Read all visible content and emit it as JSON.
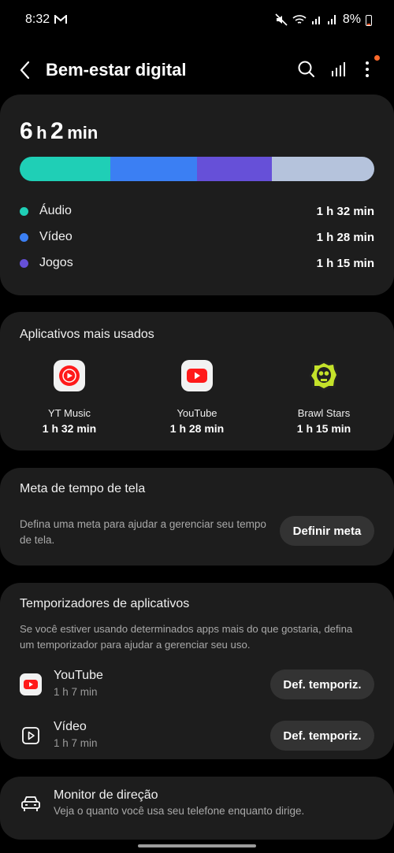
{
  "status_bar": {
    "time": "8:32",
    "mail_icon": "gmail-icon",
    "battery": "8%"
  },
  "header": {
    "title": "Bem-estar digital"
  },
  "usage": {
    "total_hours": "6",
    "hours_unit": "h",
    "total_minutes": "2",
    "minutes_unit": "min",
    "bar_segments": [
      {
        "color": "#1fcfb6",
        "fraction": 0.255
      },
      {
        "color": "#3b7ff3",
        "fraction": 0.245
      },
      {
        "color": "#6650d8",
        "fraction": 0.21
      },
      {
        "color": "#b5c3dc",
        "fraction": 0.29
      }
    ],
    "categories": [
      {
        "label": "Áudio",
        "value": "1 h 32 min",
        "color": "#1fcfb6"
      },
      {
        "label": "Vídeo",
        "value": "1 h 28 min",
        "color": "#3b7ff3"
      },
      {
        "label": "Jogos",
        "value": "1 h 15 min",
        "color": "#6650d8"
      }
    ]
  },
  "most_used": {
    "title": "Aplicativos mais usados",
    "apps": [
      {
        "name": "YT Music",
        "time": "1 h 32 min",
        "icon": "yt-music-icon"
      },
      {
        "name": "YouTube",
        "time": "1 h 28 min",
        "icon": "youtube-icon"
      },
      {
        "name": "Brawl Stars",
        "time": "1 h 15 min",
        "icon": "brawl-stars-icon"
      }
    ]
  },
  "screen_goal": {
    "title": "Meta de tempo de tela",
    "description_line1": "Defina uma meta para ajudar a gerenciar seu tempo",
    "description_line2": "de tela.",
    "button": "Definir meta"
  },
  "app_timers": {
    "title": "Temporizadores de aplicativos",
    "description_line1": "Se você estiver usando determinados apps mais do que gostaria, defina",
    "description_line2": "um temporizador para ajudar a gerenciar seu uso.",
    "items": [
      {
        "name": "YouTube",
        "time": "1 h 7 min",
        "button": "Def. temporiz.",
        "icon": "youtube-icon"
      },
      {
        "name": "Vídeo",
        "time": "1 h 7 min",
        "button": "Def. temporiz.",
        "icon": "video-play-icon"
      }
    ]
  },
  "driving": {
    "title": "Monitor de direção",
    "description": "Veja o quanto você usa seu telefone enquanto dirige."
  }
}
